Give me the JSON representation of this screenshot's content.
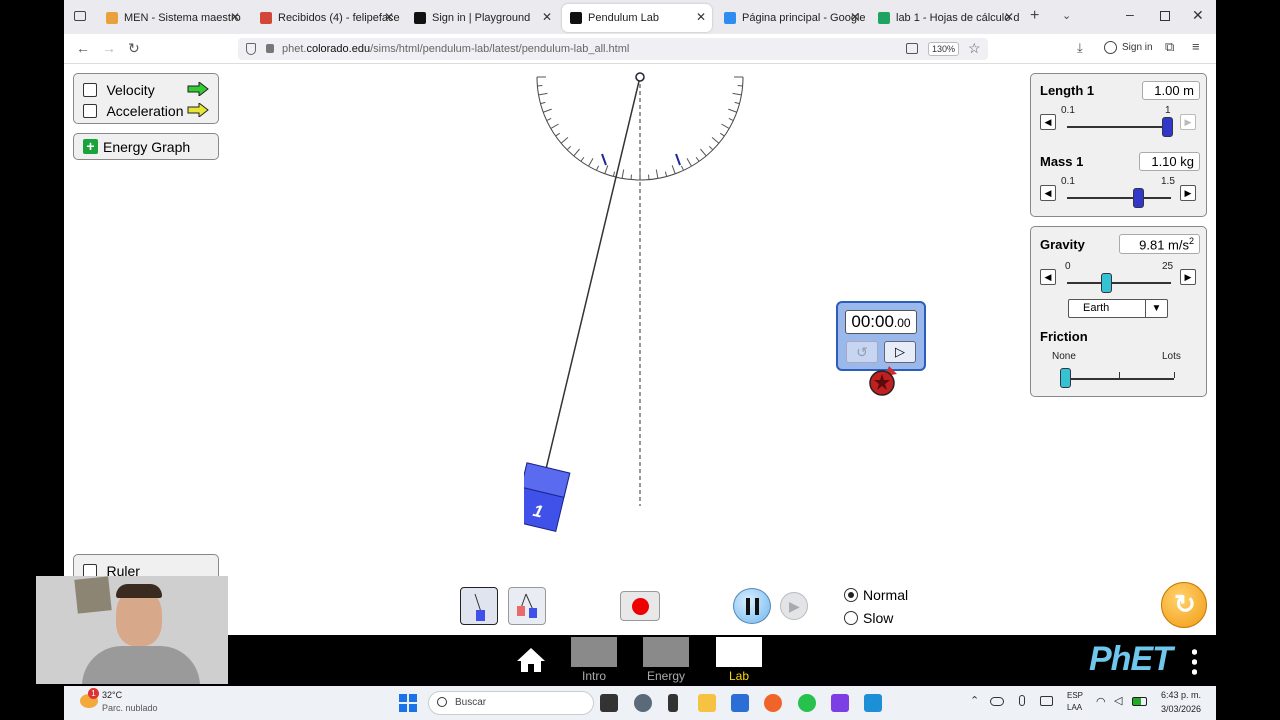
{
  "browser": {
    "tabs": [
      {
        "title": "MEN - Sistema maestro",
        "fav": "#e8a23b"
      },
      {
        "title": "Recibidos (4) - felipeface4@",
        "fav": "#d44638"
      },
      {
        "title": "Sign in | Playground",
        "fav": "#111111"
      },
      {
        "title": "Pendulum Lab",
        "fav": "#111111"
      },
      {
        "title": "Página principal - Google D",
        "fav": "#2f8cf0"
      },
      {
        "title": "lab 1 - Hojas de cálculo de G",
        "fav": "#1ea362"
      }
    ],
    "url_prefix": "phet.",
    "url_domain": "colorado.edu",
    "url_path": "/sims/html/pendulum-lab/latest/pendulum-lab_all.html",
    "zoom": "130%",
    "signin": "Sign in"
  },
  "sim": {
    "velocity_label": "Velocity",
    "acceleration_label": "Acceleration",
    "energy_graph_label": "Energy Graph",
    "ruler_label": "Ruler",
    "length_label": "Length 1",
    "length_value": "1.00 m",
    "length_min": "0.1",
    "length_max": "1",
    "mass_label": "Mass 1",
    "mass_value": "1.10 kg",
    "mass_min": "0.1",
    "mass_max": "1.5",
    "gravity_label": "Gravity",
    "gravity_value": "9.81 m/s",
    "gravity_exp": "2",
    "gravity_min": "0",
    "gravity_max": "25",
    "planet": "Earth",
    "friction_label": "Friction",
    "friction_min": "None",
    "friction_max": "Lots",
    "stopwatch_main": "00:00",
    "stopwatch_frac": ".00",
    "pendulum_number": "1",
    "speed_normal": "Normal",
    "speed_slow": "Slow",
    "screens": [
      "Intro",
      "Energy",
      "Lab"
    ],
    "brand": "PhET"
  },
  "taskbar": {
    "temp": "32°C",
    "weather": "Parc. nublado",
    "search": "Buscar",
    "lang1": "ESP",
    "lang2": "LAA",
    "time": "6:43 p. m.",
    "date": "3/03/2026",
    "weather_badge": "1"
  },
  "colors": {
    "velocity_arrow": "#33cc33",
    "acceleration_arrow": "#e6e639",
    "pendulum": "#3f51e8",
    "lab_active": "#ffd600"
  }
}
